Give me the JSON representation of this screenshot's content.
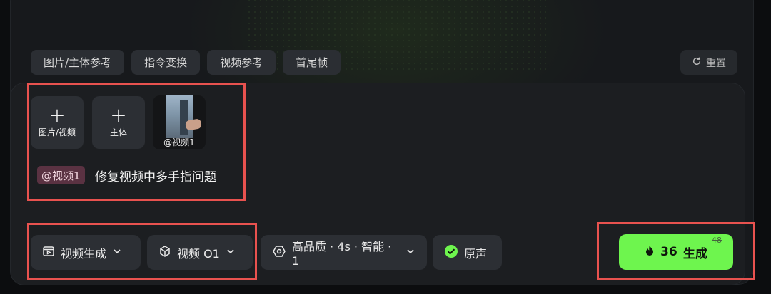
{
  "tabs": [
    "图片/主体参考",
    "指令变换",
    "视频参考",
    "首尾帧"
  ],
  "reset_label": "重置",
  "upload_tiles": [
    {
      "icon": "plus-icon",
      "label": "图片/视频"
    },
    {
      "icon": "plus-icon",
      "label": "主体"
    }
  ],
  "thumbnail": {
    "label": "@视频1"
  },
  "prompt": {
    "mention": "@视频1",
    "text": "修复视频中多手指问题"
  },
  "controls": {
    "mode": "视频生成",
    "model": "视频 O1",
    "settings": "高品质 · 4s · 智能 · 1",
    "audio": "原声"
  },
  "generate": {
    "cost": "36",
    "label": "生成",
    "original_cost": "48"
  },
  "colors": {
    "accent": "#6ef54e",
    "highlight": "#e8524f",
    "mention_bg": "#5a3242"
  }
}
